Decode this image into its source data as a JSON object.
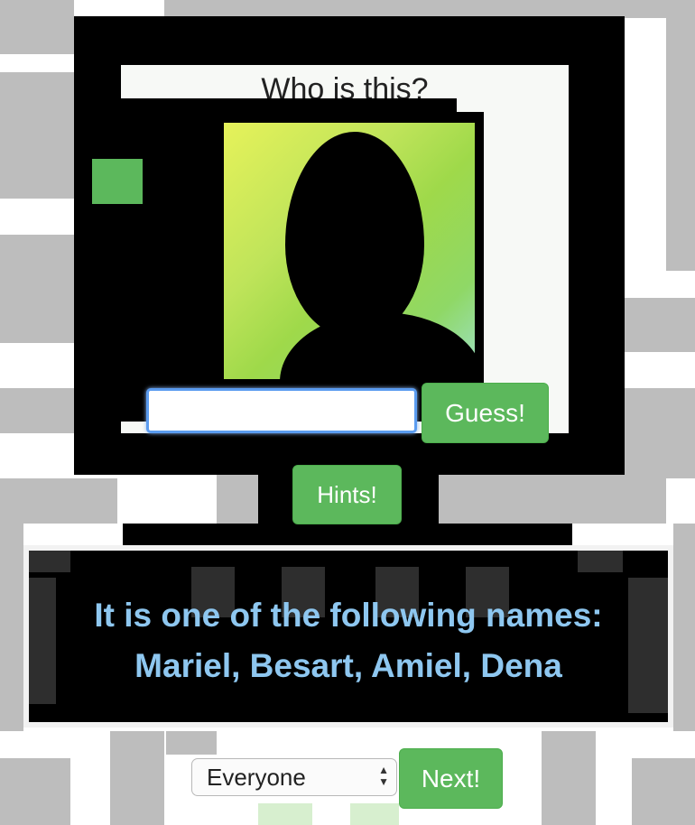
{
  "quiz": {
    "title": "Who is this?",
    "guess_input": {
      "value": "",
      "placeholder": ""
    },
    "guess_button": "Guess!",
    "hints_button": "Hints!",
    "hint_line_1": "It is one of the following names:",
    "hint_line_2": "Mariel, Besart, Amiel, Dena"
  },
  "footer": {
    "group_select": {
      "selected": "Everyone"
    },
    "next_button": "Next!"
  },
  "colors": {
    "button_green": "#5cb85c",
    "hint_text": "#8ec7f0",
    "input_focus_border": "#5b9cf0"
  },
  "icons": {
    "select_arrows": "updown-arrows-icon"
  }
}
